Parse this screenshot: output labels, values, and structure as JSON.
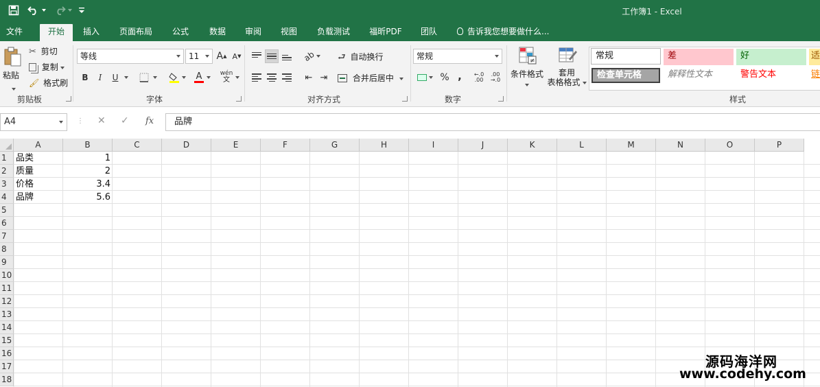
{
  "window": {
    "title": "工作簿1 - Excel"
  },
  "quick_access": {
    "save": "save-icon",
    "undo": "undo-icon",
    "redo": "redo-icon",
    "customize": "customize-icon"
  },
  "tabs": [
    {
      "label": "文件"
    },
    {
      "label": "开始"
    },
    {
      "label": "插入"
    },
    {
      "label": "页面布局"
    },
    {
      "label": "公式"
    },
    {
      "label": "数据"
    },
    {
      "label": "审阅"
    },
    {
      "label": "视图"
    },
    {
      "label": "负载测试"
    },
    {
      "label": "福昕PDF"
    },
    {
      "label": "团队"
    }
  ],
  "tell_me": "告诉我您想要做什么...",
  "ribbon": {
    "clipboard": {
      "label": "剪贴板",
      "paste": "粘贴",
      "cut": "剪切",
      "copy": "复制",
      "format_painter": "格式刷"
    },
    "font": {
      "label": "字体",
      "font_name": "等线",
      "font_size": "11",
      "bold": "B",
      "italic": "I",
      "underline": "U",
      "phonetic": "wén",
      "font_color": "A",
      "grow": "A",
      "shrink": "A"
    },
    "alignment": {
      "label": "对齐方式",
      "wrap": "自动换行",
      "merge": "合并后居中"
    },
    "number": {
      "label": "数字",
      "format": "常规",
      "percent": "%",
      "comma": ",",
      "inc_dec": "←.0 .00",
      "dec_dec": ".00 →.0"
    },
    "styles": {
      "label": "样式",
      "conditional": "条件格式",
      "table_format_1": "套用",
      "table_format_2": "表格格式",
      "cells": [
        {
          "text": "常规",
          "bg": "#ffffff",
          "color": "#000000"
        },
        {
          "text": "差",
          "bg": "#ffc7ce",
          "color": "#9c0006"
        },
        {
          "text": "好",
          "bg": "#c6efce",
          "color": "#006100"
        },
        {
          "text": "适",
          "bg": "#ffeb9c",
          "color": "#9c5700"
        },
        {
          "text": "检查单元格",
          "bg": "#a5a5a5",
          "color": "#ffffff"
        },
        {
          "text": "解释性文本",
          "bg": "#ffffff",
          "color": "#7f7f7f"
        },
        {
          "text": "警告文本",
          "bg": "#ffffff",
          "color": "#ff0000"
        },
        {
          "text": "链",
          "bg": "#ffffff",
          "color": "#fa7d00"
        }
      ]
    }
  },
  "formula_bar": {
    "name_box": "A4",
    "cancel": "✕",
    "enter": "✓",
    "fx": "fx",
    "formula": "品牌"
  },
  "sheet": {
    "columns": [
      "A",
      "B",
      "C",
      "D",
      "E",
      "F",
      "G",
      "H",
      "I",
      "J",
      "K",
      "L",
      "M",
      "N",
      "O",
      "P"
    ],
    "rows": [
      "1",
      "2",
      "3",
      "4",
      "5",
      "6",
      "7",
      "8",
      "9",
      "10",
      "11",
      "12",
      "13",
      "14",
      "15",
      "16",
      "17",
      "18"
    ],
    "data": [
      {
        "a": "品类",
        "b": "1"
      },
      {
        "a": "质量",
        "b": "2"
      },
      {
        "a": "价格",
        "b": "3.4"
      },
      {
        "a": "品牌",
        "b": "5.6"
      }
    ]
  },
  "watermark": {
    "line1": "源码海洋网",
    "line2": "www.codehy.com"
  },
  "colors": {
    "brand": "#217346",
    "ribbon": "#f3f3f3"
  }
}
